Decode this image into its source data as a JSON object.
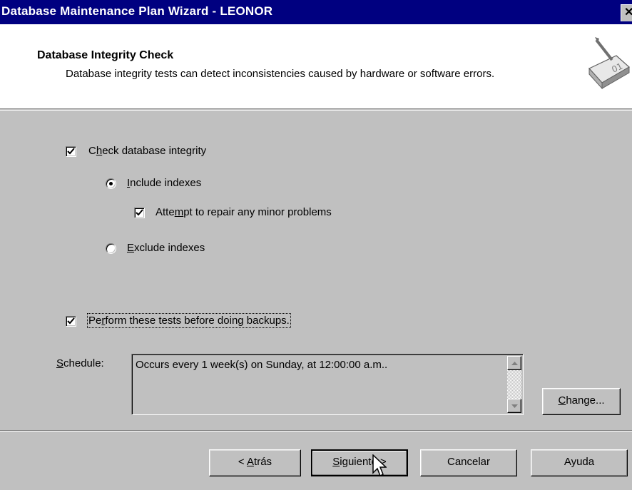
{
  "window": {
    "title": "Database Maintenance Plan Wizard - LEONOR",
    "close_glyph": "✕"
  },
  "header": {
    "title": "Database Integrity Check",
    "subtitle": "Database integrity tests can detect inconsistencies caused by hardware or software errors."
  },
  "options": {
    "check_integrity": {
      "pre": "C",
      "accel": "h",
      "post": "eck database integrity",
      "checked": true
    },
    "include_indexes": {
      "pre": "",
      "accel": "I",
      "post": "nclude indexes",
      "selected": true
    },
    "attempt_repair": {
      "pre": "Atte",
      "accel": "m",
      "post": "pt to repair any minor problems",
      "checked": true
    },
    "exclude_indexes": {
      "pre": "",
      "accel": "E",
      "post": "xclude indexes",
      "selected": false
    },
    "perform_before_backup": {
      "pre": "Pe",
      "accel": "r",
      "post": "form these tests before doing backups.",
      "checked": true
    }
  },
  "schedule": {
    "label_accel": "S",
    "label_rest": "chedule:",
    "value": "Occurs every 1 week(s) on Sunday, at 12:00:00 a.m..",
    "change_accel": "C",
    "change_rest": "hange..."
  },
  "buttons": {
    "back_pre": "< ",
    "back_accel": "A",
    "back_rest": "trás",
    "next_accel": "S",
    "next_rest": "iguiente >",
    "cancel": "Cancelar",
    "help": "Ayuda"
  },
  "colors": {
    "titlebar": "#000080",
    "face": "#c0c0c0",
    "header_bg": "#ffffff"
  }
}
